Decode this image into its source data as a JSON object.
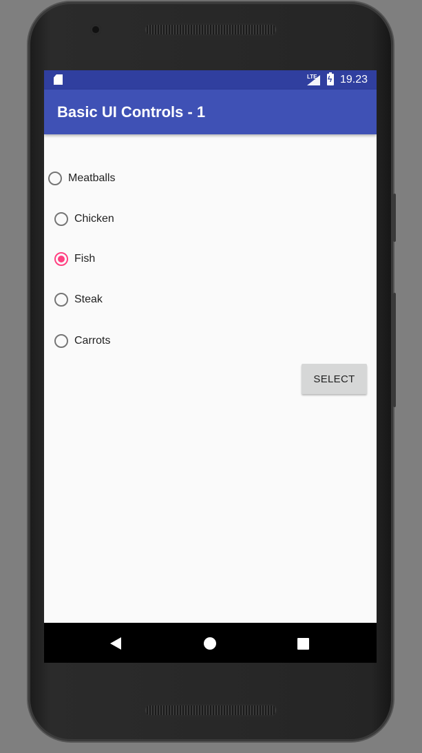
{
  "status_bar": {
    "network_label": "LTE",
    "time": "19.23",
    "icons": [
      "sd-card-icon",
      "signal-icon",
      "battery-charging-icon"
    ]
  },
  "app_bar": {
    "title": "Basic UI Controls - 1"
  },
  "radio_group": {
    "options": [
      {
        "label": "Meatballs",
        "checked": false
      },
      {
        "label": "Chicken",
        "checked": false
      },
      {
        "label": "Fish",
        "checked": true
      },
      {
        "label": "Steak",
        "checked": false
      },
      {
        "label": "Carrots",
        "checked": false
      }
    ]
  },
  "select_button": {
    "label": "SELECT"
  },
  "nav_bar": {
    "icons": [
      "back-icon",
      "home-icon",
      "recents-icon"
    ]
  },
  "colors": {
    "primary": "#3f51b5",
    "primary_dark": "#303f9f",
    "accent": "#ff4081"
  }
}
